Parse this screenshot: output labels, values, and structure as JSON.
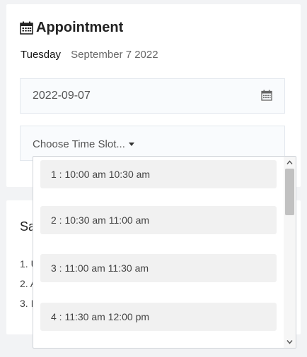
{
  "appointment": {
    "title": "Appointment",
    "day": "Tuesday",
    "date_text": "September 7 2022",
    "date_input_value": "2022-09-07",
    "time_select_label": "Choose Time Slot..."
  },
  "secondary_card": {
    "heading": "Sa",
    "items": [
      "1. U",
      "2. A",
      "3. I"
    ]
  },
  "time_slots": [
    "1 : 10:00 am 10:30 am",
    "2 : 10:30 am 11:00 am",
    "3 : 11:00 am 11:30 am",
    "4 : 11:30 am 12:00 pm"
  ],
  "icons": {
    "title_icon": "calendar-icon",
    "date_input_icon": "calendar-icon"
  },
  "colors": {
    "accent_text": "#222222",
    "muted_text": "#666666",
    "option_bg": "#f1f1f1"
  }
}
